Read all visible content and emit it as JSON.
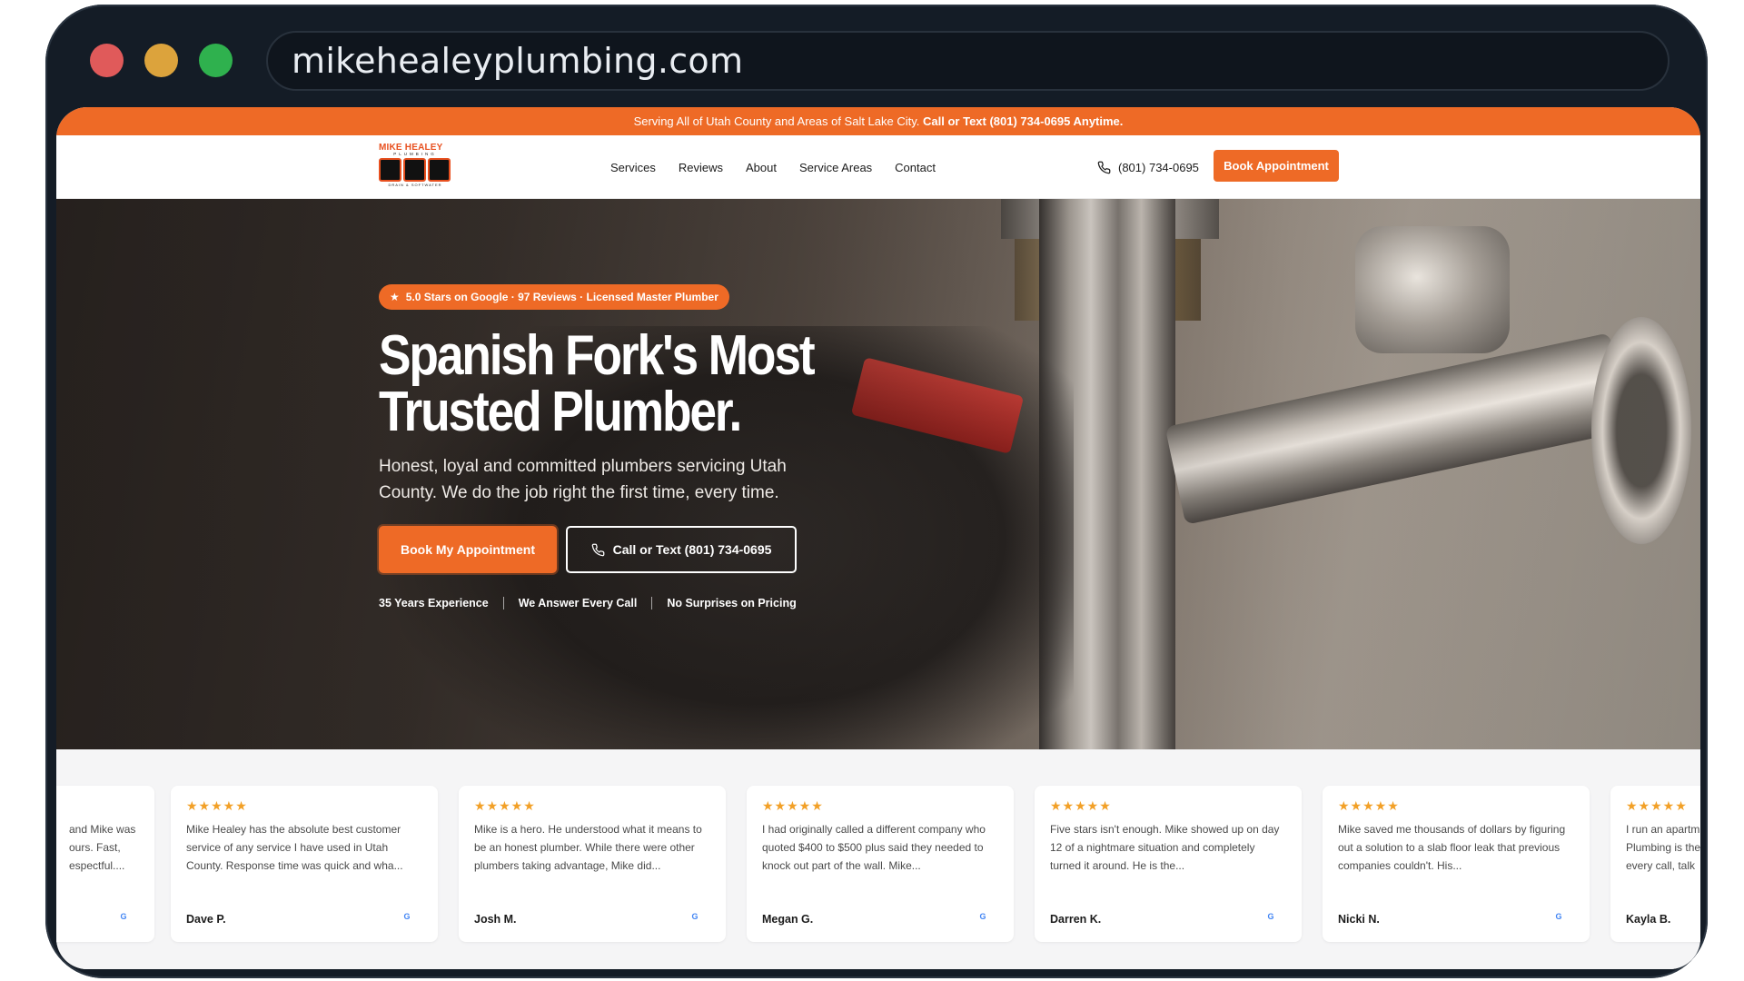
{
  "browser": {
    "url": "mikehealeyplumbing.com"
  },
  "announcement": {
    "text": "Serving All of Utah County and Areas of Salt Lake City.",
    "cta": "Call or Text (801) 734-0695 Anytime."
  },
  "logo": {
    "title": "MIKE HEALEY",
    "subtitle": "PLUMBING",
    "tagline": "DRAIN & SOFTWATER"
  },
  "nav": {
    "items": [
      "Services",
      "Reviews",
      "About",
      "Service Areas",
      "Contact"
    ],
    "phone": "(801) 734-0695",
    "book_label": "Book Appointment"
  },
  "hero": {
    "badge": "5.0 Stars on Google · 97 Reviews · Licensed Master Plumber",
    "title_line1": "Spanish Fork's Most",
    "title_line2": "Trusted Plumber.",
    "description": "Honest, loyal and committed plumbers servicing Utah County. We do the job right the first time, every time.",
    "primary_button": "Book My Appointment",
    "secondary_button": "Call or Text (801) 734-0695",
    "features": [
      "35 Years Experience",
      "We Answer Every Call",
      "No Surprises on Pricing"
    ]
  },
  "reviews": [
    {
      "stars": "★★★★★",
      "text": "and Mike was ours. Fast, espectful....",
      "author": "",
      "source": "G"
    },
    {
      "stars": "★★★★★",
      "text": "Mike Healey has the absolute best customer service of any service I have used in Utah County. Response time was quick and wha...",
      "author": "Dave P.",
      "source": "G"
    },
    {
      "stars": "★★★★★",
      "text": "Mike is a hero. He understood what it means to be an honest plumber. While there were other plumbers taking advantage, Mike did...",
      "author": "Josh M.",
      "source": "G"
    },
    {
      "stars": "★★★★★",
      "text": "I had originally called a different company who quoted $400 to $500 plus said they needed to knock out part of the wall. Mike...",
      "author": "Megan G.",
      "source": "G"
    },
    {
      "stars": "★★★★★",
      "text": "Five stars isn't enough. Mike showed up on day 12 of a nightmare situation and completely turned it around. He is the...",
      "author": "Darren K.",
      "source": "G"
    },
    {
      "stars": "★★★★★",
      "text": "Mike saved me thousands of dollars by figuring out a solution to a slab floor leak that previous companies couldn't. His...",
      "author": "Nicki N.",
      "source": "G"
    },
    {
      "stars": "★★★★★",
      "text": "I run an apartm Plumbing is the every call, talk",
      "author": "Kayla B.",
      "source": "G"
    }
  ]
}
